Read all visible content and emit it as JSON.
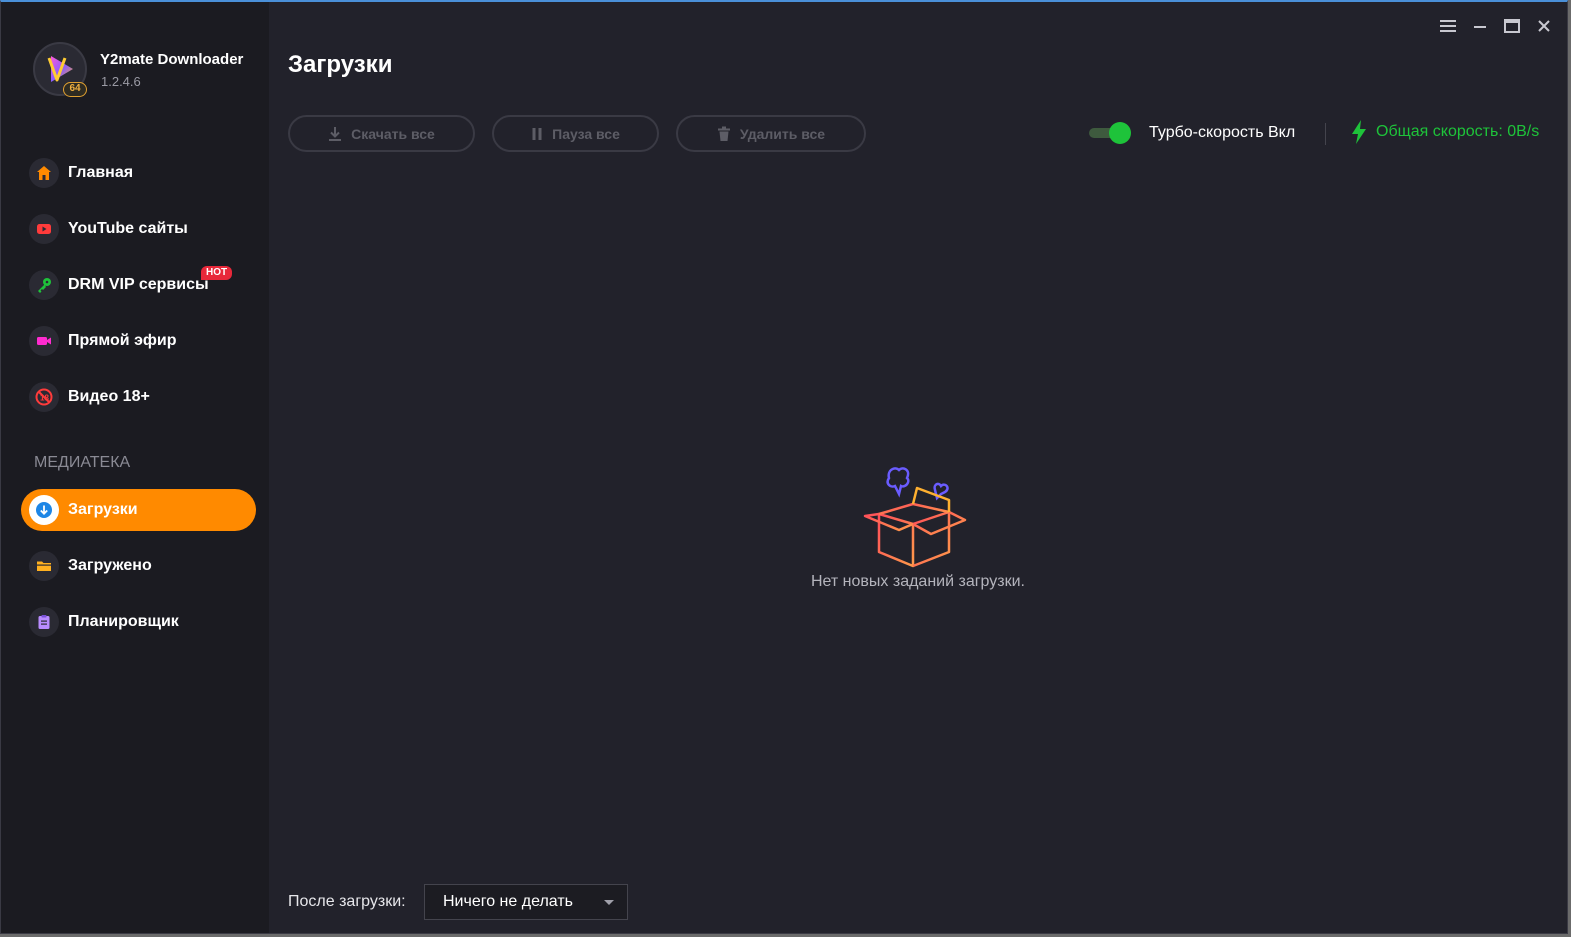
{
  "app": {
    "name": "Y2mate Downloader",
    "version": "1.2.4.6",
    "badge": "64"
  },
  "sidebar": {
    "items": [
      {
        "label": "Главная",
        "icon": "home-icon",
        "color": "#ff8a00"
      },
      {
        "label": "YouTube сайты",
        "icon": "youtube-icon",
        "color": "#ff3b3b"
      },
      {
        "label": "DRM VIP сервисы",
        "icon": "key-icon",
        "color": "#1ec33a",
        "badge": "HOT"
      },
      {
        "label": "Прямой эфир",
        "icon": "video-camera-icon",
        "color": "#ff2bd0"
      },
      {
        "label": "Видео 18+",
        "icon": "adult-icon",
        "color": "#ff3b3b"
      }
    ],
    "section_title": "МЕДИАТЕКА",
    "library": [
      {
        "label": "Загрузки",
        "icon": "download-icon",
        "active": true
      },
      {
        "label": "Загружено",
        "icon": "folder-icon",
        "color": "#ffb020"
      },
      {
        "label": "Планировщик",
        "icon": "clipboard-icon",
        "color": "#b98cff"
      }
    ]
  },
  "main": {
    "title": "Загрузки",
    "toolbar": {
      "download_all": "Скачать все",
      "pause_all": "Пауза все",
      "delete_all": "Удалить все"
    },
    "turbo": {
      "label": "Турбо-скорость Вкл",
      "enabled": true
    },
    "speed": "Общая скорость: 0B/s",
    "empty_text": "Нет новых заданий загрузки.",
    "footer": {
      "after_label": "После загрузки:",
      "after_value": "Ничего не делать"
    }
  },
  "colors": {
    "accent": "#ff8a00",
    "green": "#1ec33a",
    "bg": "#22222b",
    "sidebar_bg": "#1b1b21"
  }
}
